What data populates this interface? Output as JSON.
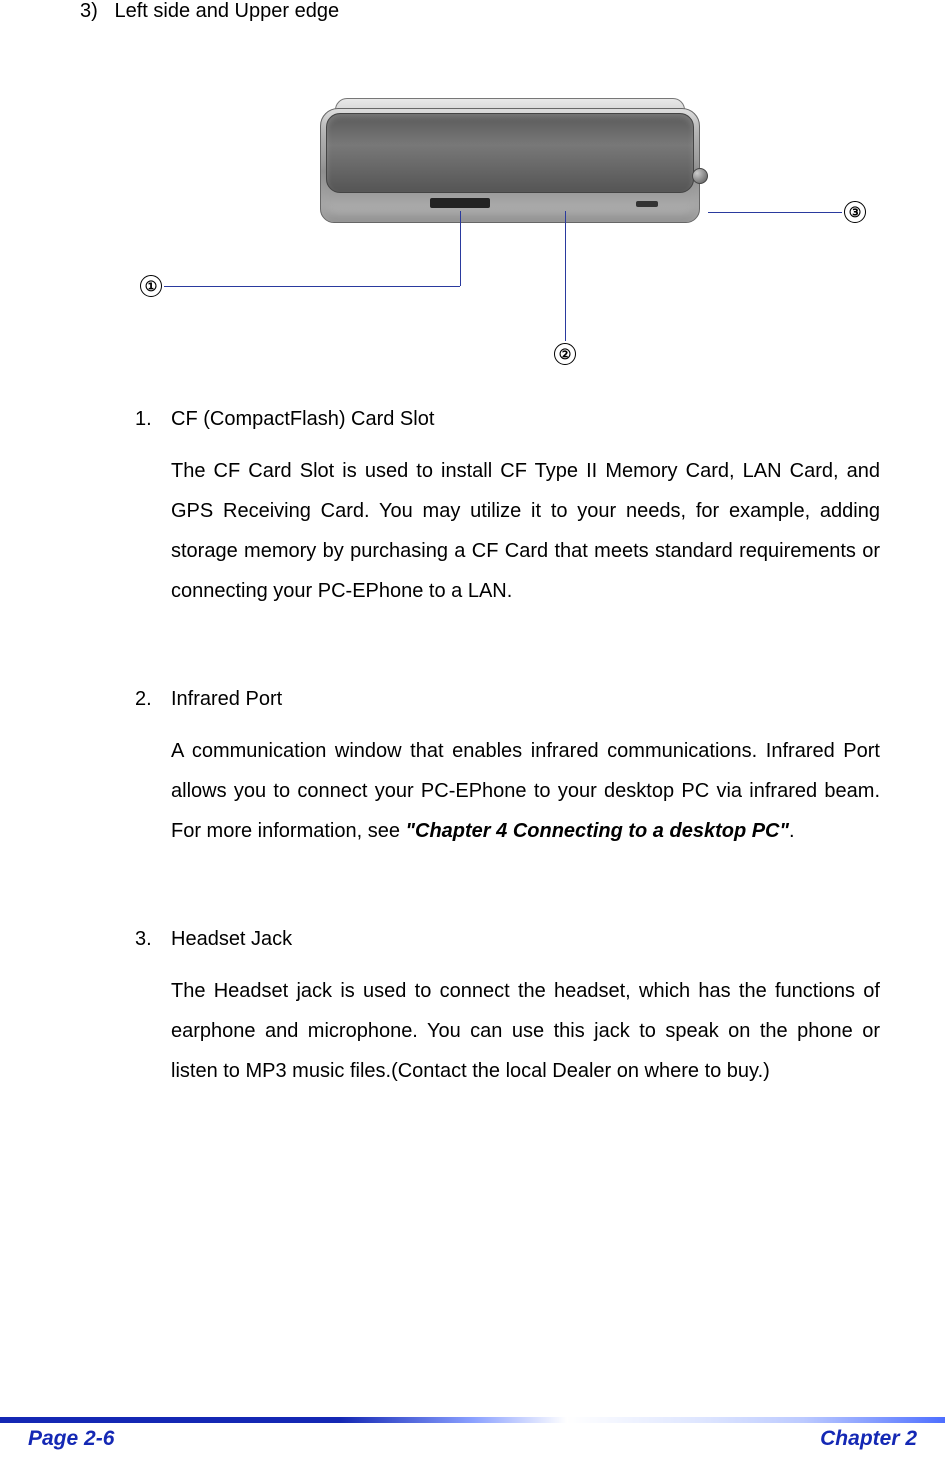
{
  "heading": {
    "number": "3)",
    "title": "Left side and Upper edge"
  },
  "callouts": {
    "one": "①",
    "two": "②",
    "three": "③"
  },
  "items": [
    {
      "num": "1.",
      "title": "CF (CompactFlash) Card Slot",
      "body_plain": "The CF Card Slot is used to install CF Type II Memory Card, LAN Card, and GPS Receiving Card. You may utilize it to your needs, for example, adding storage memory by purchasing a CF Card that meets standard requirements or connecting your PC-EPhone to a LAN."
    },
    {
      "num": "2.",
      "title": "Infrared Port",
      "body_pre": "A communication window that enables infrared communications. Infrared Port allows you to connect your PC-EPhone to your desktop PC via infrared beam. For more information, see ",
      "body_bold": "\"Chapter 4 Connecting to a desktop PC\"",
      "body_post": "."
    },
    {
      "num": "3.",
      "title": "Headset Jack",
      "body_plain": "The Headset jack is used to connect the headset, which has the functions of earphone and microphone. You can use this jack to speak on the phone or listen to  MP3 music files.(Contact the local Dealer on where to buy.)"
    }
  ],
  "footer": {
    "left": "Page 2-6",
    "right": "Chapter 2"
  }
}
